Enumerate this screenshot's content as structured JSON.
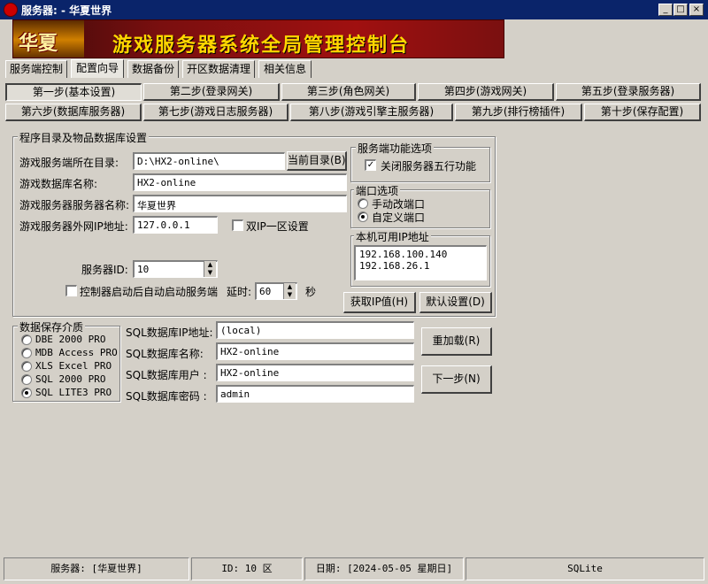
{
  "window": {
    "title": "服务器: - 华夏世界",
    "min": "_",
    "max": "□",
    "close": "×"
  },
  "banner": {
    "logo": "华夏",
    "title": "游戏服务器系统全局管理控制台"
  },
  "main_tabs": [
    {
      "label": "服务端控制"
    },
    {
      "label": "配置向导"
    },
    {
      "label": "数据备份"
    },
    {
      "label": "开区数据清理"
    },
    {
      "label": "相关信息"
    }
  ],
  "steps": [
    {
      "label": "第一步(基本设置)"
    },
    {
      "label": "第二步(登录网关)"
    },
    {
      "label": "第三步(角色网关)"
    },
    {
      "label": "第四步(游戏网关)"
    },
    {
      "label": "第五步(登录服务器)"
    },
    {
      "label": "第六步(数据库服务器)"
    },
    {
      "label": "第七步(游戏日志服务器)"
    },
    {
      "label": "第八步(游戏引擎主服务器)"
    },
    {
      "label": "第九步(排行榜插件)"
    },
    {
      "label": "第十步(保存配置)"
    }
  ],
  "dir_group": {
    "legend": "程序目录及物品数据库设置",
    "server_dir_label": "游戏服务端所在目录:",
    "server_dir_value": "D:\\HX2-online\\",
    "current_dir_button": "当前目录(B)",
    "db_name_label": "游戏数据库名称:",
    "db_name_value": "HX2-online",
    "server_name_label": "游戏服务器服务器名称:",
    "server_name_value": "华夏世界",
    "ip_label": "游戏服务器外网IP地址:",
    "ip_value": "127.0.0.1",
    "dual_ip_label": "双IP一区设置",
    "server_id_label": "服务器ID:",
    "server_id_value": "10",
    "autostart_label": "控制器启动后自动启动服务端",
    "delay_label": "延时:",
    "delay_value": "60",
    "delay_unit": "秒"
  },
  "func_group": {
    "legend": "服务端功能选项",
    "close_five_label": "关闭服务器五行功能"
  },
  "port_group": {
    "legend": "端口选项",
    "manual_label": "手动改端口",
    "custom_label": "自定义端口"
  },
  "ip_group": {
    "legend": "本机可用IP地址",
    "ips": [
      "192.168.100.140",
      "192.168.26.1"
    ]
  },
  "buttons": {
    "get_ip": "获取IP值(H)",
    "default": "默认设置(D)",
    "reload": "重加载(R)",
    "next": "下一步(N)"
  },
  "storage": {
    "legend": "数据保存介质",
    "options": [
      {
        "label": "DBE 2000 PRO",
        "selected": false
      },
      {
        "label": "MDB Access PRO",
        "selected": false
      },
      {
        "label": "XLS Excel PRO",
        "selected": false
      },
      {
        "label": "SQL 2000 PRO",
        "selected": false
      },
      {
        "label": "SQL LITE3 PRO",
        "selected": true
      }
    ]
  },
  "sql": {
    "ip_label": "SQL数据库IP地址:",
    "ip_value": "(local)",
    "name_label": "SQL数据库名称:",
    "name_value": "HX2-online",
    "user_label": "SQL数据库用户 :",
    "user_value": "HX2-online",
    "pwd_label": "SQL数据库密码 :",
    "pwd_value": "admin"
  },
  "statusbar": {
    "server": "服务器: [华夏世界]",
    "id": "ID: 10 区",
    "date": "日期: [2024-05-05 星期日]",
    "db": "SQLite"
  },
  "colors": {
    "titlebar": "#0a246a",
    "face": "#d4d0c8",
    "banner": "#a01010",
    "banner_text": "#ffd700"
  }
}
